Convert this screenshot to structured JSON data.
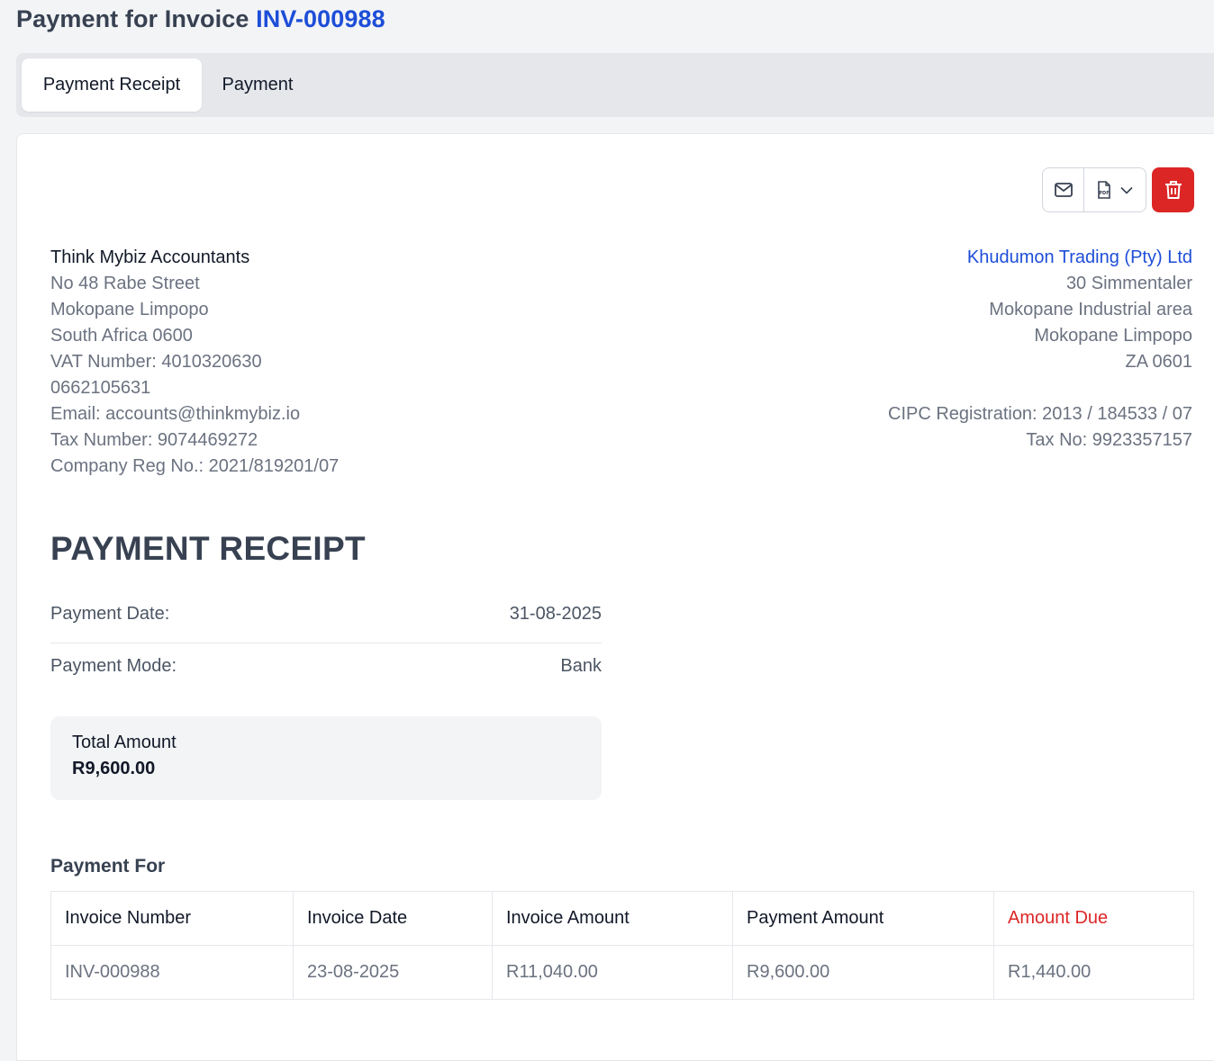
{
  "header": {
    "title_prefix": "Payment for Invoice",
    "invoice_number": "INV-000988"
  },
  "tabs": [
    {
      "label": "Payment Receipt",
      "active": true
    },
    {
      "label": "Payment",
      "active": false
    }
  ],
  "toolbar": {
    "icons": [
      "mail-icon",
      "pdf-icon",
      "chevron-down-icon",
      "trash-icon"
    ],
    "delete_color": "#dc2626"
  },
  "from": {
    "name": "Think Mybiz Accountants",
    "lines": [
      "No 48 Rabe Street",
      "Mokopane Limpopo",
      "South Africa 0600",
      "VAT Number: 4010320630",
      "0662105631",
      "Email: accounts@thinkmybiz.io",
      "Tax Number: 9074469272",
      "Company Reg No.: 2021/819201/07"
    ]
  },
  "to": {
    "name": "Khudumon Trading (Pty) Ltd",
    "lines": [
      "30 Simmentaler",
      "Mokopane Industrial area",
      "Mokopane Limpopo",
      "ZA 0601"
    ],
    "extra_lines": [
      "CIPC Registration: 2013 / 184533 / 07",
      "Tax No: 9923357157"
    ]
  },
  "receipt": {
    "heading": "PAYMENT RECEIPT",
    "payment_date_label": "Payment Date:",
    "payment_date": "31-08-2025",
    "payment_mode_label": "Payment Mode:",
    "payment_mode": "Bank",
    "total_label": "Total Amount",
    "total_amount": "R9,600.00"
  },
  "payment_for": {
    "title": "Payment For",
    "columns": [
      "Invoice Number",
      "Invoice Date",
      "Invoice Amount",
      "Payment Amount",
      "Amount Due"
    ],
    "rows": [
      [
        "INV-000988",
        "23-08-2025",
        "R11,040.00",
        "R9,600.00",
        "R1,440.00"
      ]
    ]
  },
  "colors": {
    "accent": "#1d4ed8",
    "danger": "#dc2626"
  }
}
